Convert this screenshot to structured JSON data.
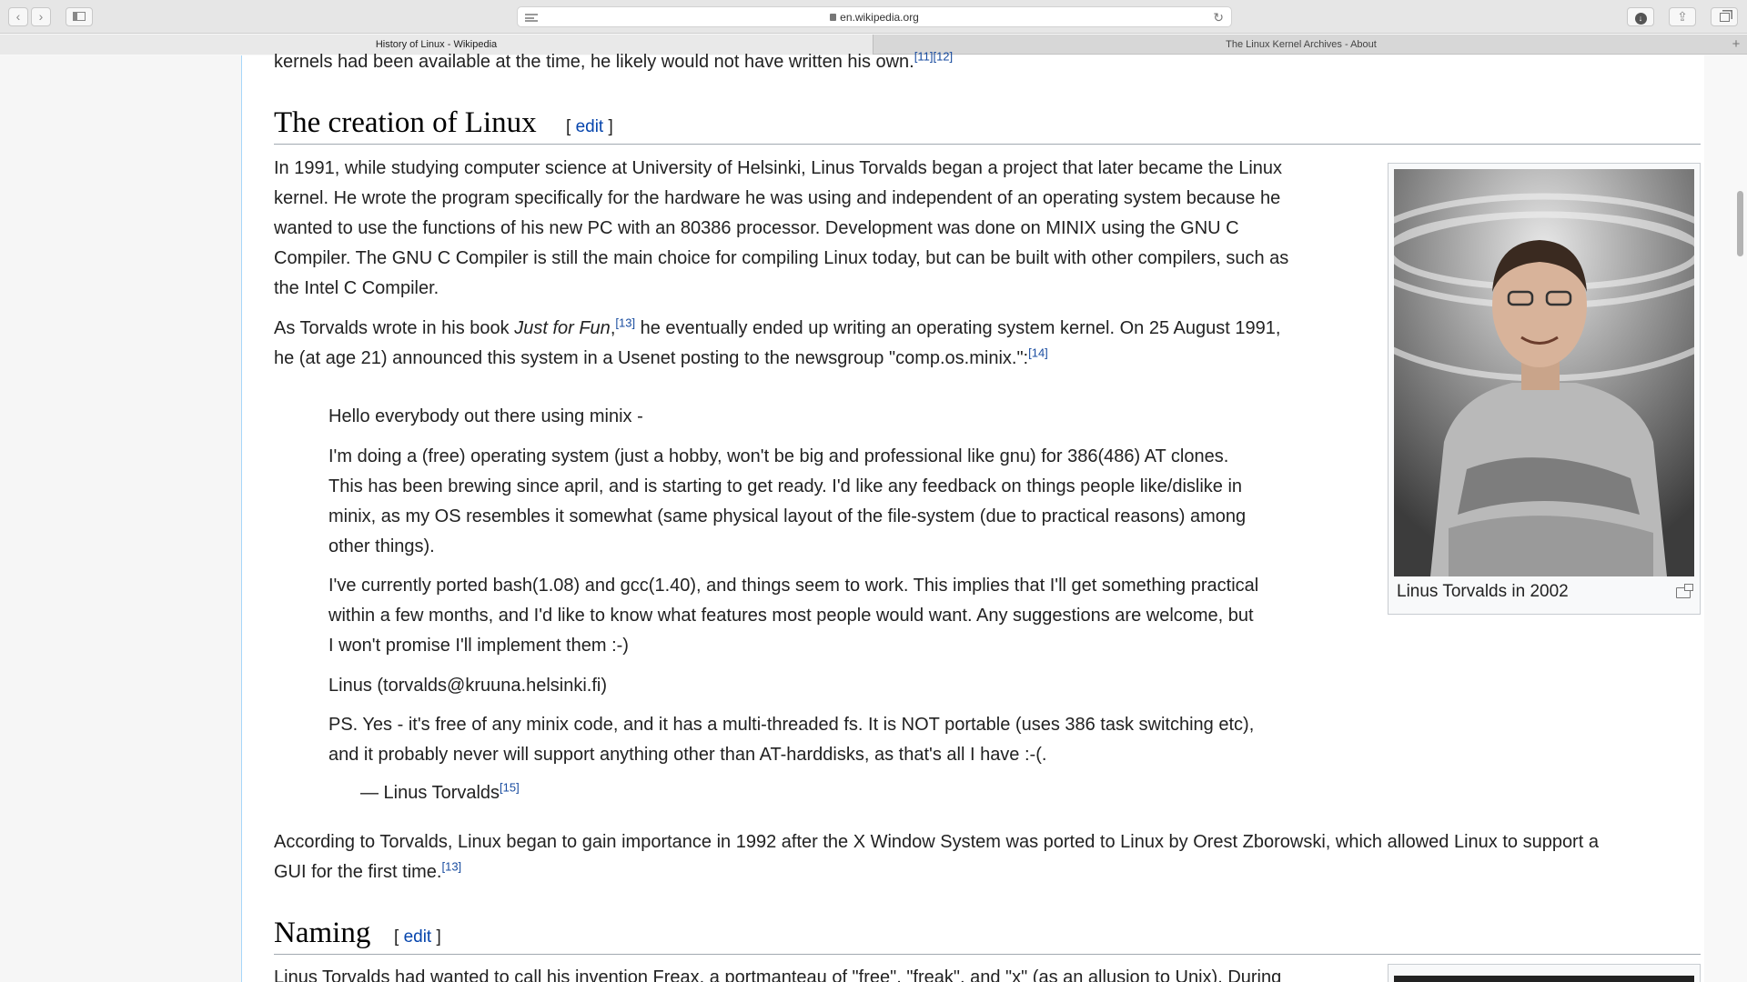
{
  "browser": {
    "url": "en.wikipedia.org",
    "tabs": [
      {
        "label": "History of Linux - Wikipedia",
        "active": true
      },
      {
        "label": "The Linux Kernel Archives - About",
        "active": false
      }
    ]
  },
  "article": {
    "top_fragment": "kernels had been available at the time, he likely would not have written his own.",
    "top_fragment_refs": "[11][12]",
    "section1": {
      "title": "The creation of Linux",
      "edit_open": "[ ",
      "edit_label": "edit",
      "edit_close": " ]"
    },
    "p1_lines": [
      "In 1991, while studying computer science at University of Helsinki, Linus Torvalds began a project that later became the Linux",
      "kernel. He wrote the program specifically for the hardware he was using and independent of an operating system because he",
      "wanted to use the functions of his new PC with an 80386 processor. Development was done on MINIX using the GNU C",
      "Compiler. The GNU C Compiler is still the main choice for compiling Linux today, but can be built with other compilers, such as",
      "the Intel C Compiler."
    ],
    "p2": {
      "a": "As Torvalds wrote in his book ",
      "book": "Just for Fun",
      "b": ",",
      "ref1": "[13]",
      "c": " he eventually ended up writing an operating system kernel. On 25 August 1991,",
      "line2": "he (at age 21) announced this system in a Usenet posting to the newsgroup \"comp.os.minix.\":",
      "ref2": "[14]"
    },
    "quote": {
      "q1": "Hello everybody out there using minix -",
      "q2_lines": [
        "I'm doing a (free) operating system (just a hobby, won't be big and professional like gnu) for 386(486) AT clones.",
        "This has been brewing since april, and is starting to get ready. I'd like any feedback on things people like/dislike in",
        "minix, as my OS resembles it somewhat (same physical layout of the file-system (due to practical reasons) among",
        "other things)."
      ],
      "q3_lines": [
        "I've currently ported bash(1.08) and gcc(1.40), and things seem to work. This implies that I'll get something practical",
        "within a few months, and I'd like to know what features most people would want. Any suggestions are welcome, but",
        "I won't promise I'll implement them :-)"
      ],
      "q4": "Linus (torvalds@kruuna.helsinki.fi)",
      "q5_lines": [
        "PS. Yes - it's free of any minix code, and it has a multi-threaded fs. It is NOT portable (uses 386 task switching etc),",
        "and it probably never will support anything other than AT-harddisks, as that's all I have :-(."
      ],
      "attribution": "— Linus Torvalds",
      "attribution_ref": "[15]"
    },
    "p3_line1": "According to Torvalds, Linux began to gain importance in 1992 after the X Window System was ported to Linux by Orest Zborowski, which allowed Linux to support a",
    "p3_line2": "GUI for the first time.",
    "p3_ref": "[13]",
    "figure": {
      "caption": "Linus Torvalds in 2002"
    },
    "section2": {
      "title": "Naming",
      "edit_open": "[ ",
      "edit_label": "edit",
      "edit_close": " ]"
    },
    "p4_fragment": "Linus Torvalds had wanted to call his invention Freax, a portmanteau of \"free\", \"freak\", and \"x\" (as an allusion to Unix). During"
  },
  "colors": {
    "link": "#0645ad",
    "ref": "#1a4da0",
    "heading_rule": "#a2a9b1",
    "panel_border": "#a7d7f9"
  }
}
